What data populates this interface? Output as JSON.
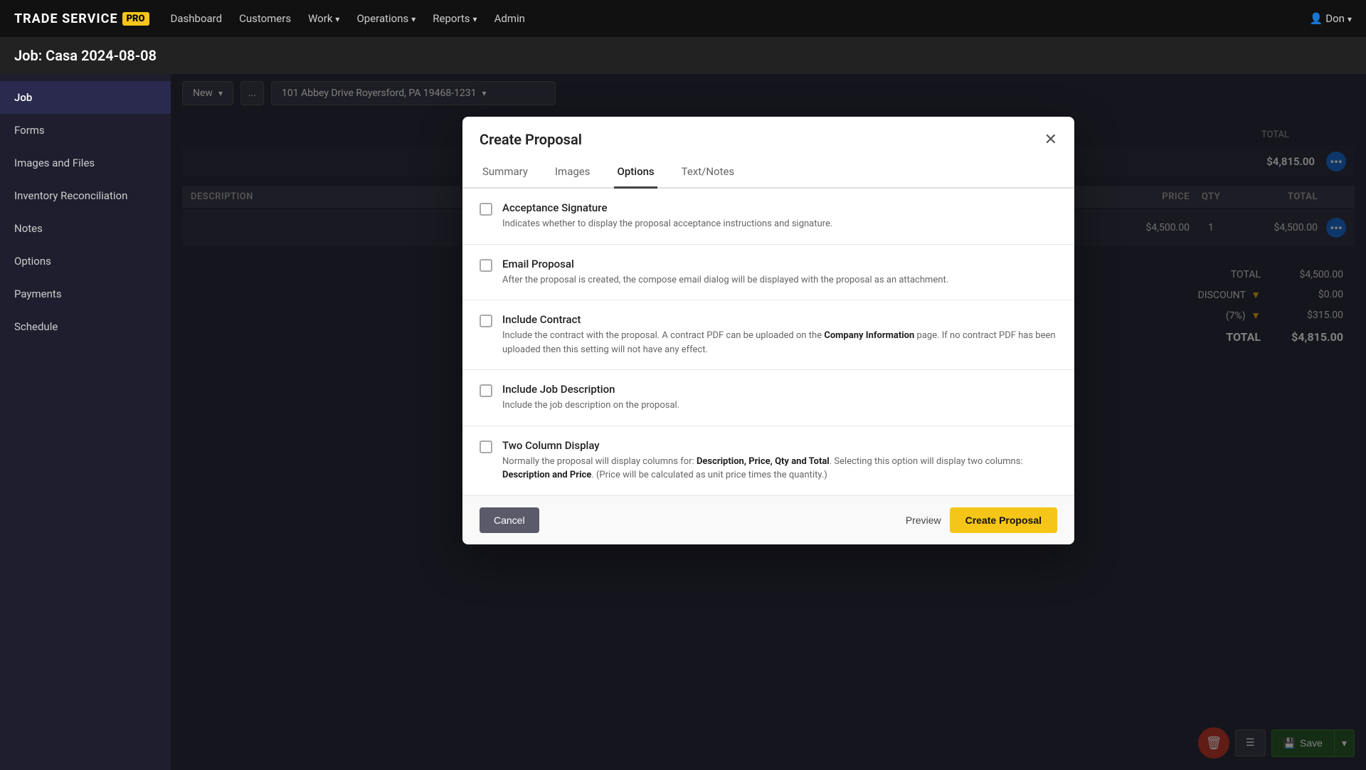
{
  "app": {
    "logo_text": "TRADE SERVICE",
    "logo_pro": "PRO"
  },
  "nav": {
    "links": [
      {
        "id": "dashboard",
        "label": "Dashboard"
      },
      {
        "id": "customers",
        "label": "Customers"
      },
      {
        "id": "work",
        "label": "Work",
        "dropdown": true
      },
      {
        "id": "operations",
        "label": "Operations",
        "dropdown": true
      },
      {
        "id": "reports",
        "label": "Reports",
        "dropdown": true
      },
      {
        "id": "admin",
        "label": "Admin"
      }
    ],
    "user": "Don"
  },
  "job": {
    "title": "Job: Casa 2024-08-08"
  },
  "sidebar": {
    "items": [
      {
        "id": "job",
        "label": "Job",
        "active": true
      },
      {
        "id": "forms",
        "label": "Forms"
      },
      {
        "id": "images-and-files",
        "label": "Images and Files"
      },
      {
        "id": "inventory-reconciliation",
        "label": "Inventory Reconciliation"
      },
      {
        "id": "notes",
        "label": "Notes"
      },
      {
        "id": "options",
        "label": "Options"
      },
      {
        "id": "payments",
        "label": "Payments"
      },
      {
        "id": "schedule",
        "label": "Schedule"
      }
    ]
  },
  "toolbar": {
    "status": "New",
    "address": "101 Abbey Drive Royersford, PA 19468-1231",
    "dots": "..."
  },
  "table": {
    "columns": [
      "DESCRIPTION",
      "PRICE",
      "QTY",
      "TOTAL"
    ],
    "rows": [
      {
        "description": "",
        "price": "$4,500.00",
        "qty": "1",
        "total": "$4,500.00"
      }
    ],
    "totals": {
      "subtotal_label": "TOTAL",
      "subtotal_value": "$4,500.00",
      "discount_label": "DISCOUNT",
      "discount_value": "$0.00",
      "tax_label": "(7%)",
      "tax_value": "$315.00",
      "grand_total_label": "TOTAL",
      "grand_total_value": "$4,815.00"
    }
  },
  "top_total": {
    "value": "$4,815.00"
  },
  "bottom_toolbar": {
    "save_label": "Save"
  },
  "modal": {
    "title": "Create Proposal",
    "tabs": [
      {
        "id": "summary",
        "label": "Summary"
      },
      {
        "id": "images",
        "label": "Images"
      },
      {
        "id": "options",
        "label": "Options",
        "active": true
      },
      {
        "id": "text-notes",
        "label": "Text/Notes"
      }
    ],
    "options": [
      {
        "id": "acceptance-signature",
        "title": "Acceptance Signature",
        "description": "Indicates whether to display the proposal acceptance instructions and signature.",
        "checked": false
      },
      {
        "id": "email-proposal",
        "title": "Email Proposal",
        "description": "After the proposal is created, the compose email dialog will be displayed with the proposal as an attachment.",
        "checked": false
      },
      {
        "id": "include-contract",
        "title": "Include Contract",
        "description_parts": [
          {
            "text": "Include the contract with the proposal. A contract PDF can be uploaded on the ",
            "bold": false
          },
          {
            "text": "Company Information",
            "bold": true
          },
          {
            "text": " page. If no contract PDF has been uploaded then this setting will not have any effect.",
            "bold": false
          }
        ],
        "checked": false
      },
      {
        "id": "include-job-description",
        "title": "Include Job Description",
        "description": "Include the job description on the proposal.",
        "checked": false
      },
      {
        "id": "two-column-display",
        "title": "Two Column Display",
        "description_parts": [
          {
            "text": "Normally the proposal will display columns for: ",
            "bold": false
          },
          {
            "text": "Description, Price, Qty and Total",
            "bold": true
          },
          {
            "text": ". Selecting this option will display two columns: ",
            "bold": false
          },
          {
            "text": "Description and Price",
            "bold": true
          },
          {
            "text": ". (Price will be calculated as unit price times the quantity.)",
            "bold": false
          }
        ],
        "checked": false
      }
    ],
    "footer": {
      "cancel_label": "Cancel",
      "preview_label": "Preview",
      "create_label": "Create Proposal"
    }
  }
}
